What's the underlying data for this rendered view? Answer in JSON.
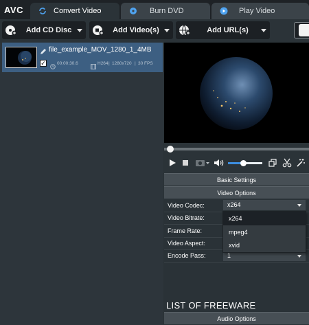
{
  "app": {
    "logo": "AVC"
  },
  "tabs": [
    {
      "label": "Convert Video",
      "icon": "refresh-icon",
      "active": true
    },
    {
      "label": "Burn DVD",
      "icon": "disc-icon",
      "active": false
    },
    {
      "label": "Play Video",
      "icon": "play-circle-icon",
      "active": false
    }
  ],
  "toolbar": {
    "add_cd_disc": "Add CD Disc",
    "add_videos": "Add Video(s)",
    "add_urls": "Add URL(s)"
  },
  "file": {
    "name": "file_example_MOV_1280_1_4MB",
    "duration": "00:00:30.6",
    "codec": "H264",
    "resolution": "1280x720",
    "fps": "30 FPS",
    "checked": true
  },
  "player": {
    "progress": 0.02,
    "volume": 0.44
  },
  "settings": {
    "basic_header": "Basic Settings",
    "video_header": "Video Options",
    "audio_header": "Audio Options",
    "rows": [
      {
        "label": "Video Codec:",
        "value": "x264"
      },
      {
        "label": "Video Bitrate:",
        "value": ""
      },
      {
        "label": "Frame Rate:",
        "value": ""
      },
      {
        "label": "Video Aspect:",
        "value": ""
      },
      {
        "label": "Encode Pass:",
        "value": "1"
      }
    ],
    "codec_options": [
      "x264",
      "mpeg4",
      "xvid"
    ],
    "codec_selected": "x264"
  },
  "watermark": "LIST OF FREEWARE",
  "colors": {
    "selection": "#3d5f82",
    "accent": "#3d8ee0",
    "background": "#2b3338"
  }
}
